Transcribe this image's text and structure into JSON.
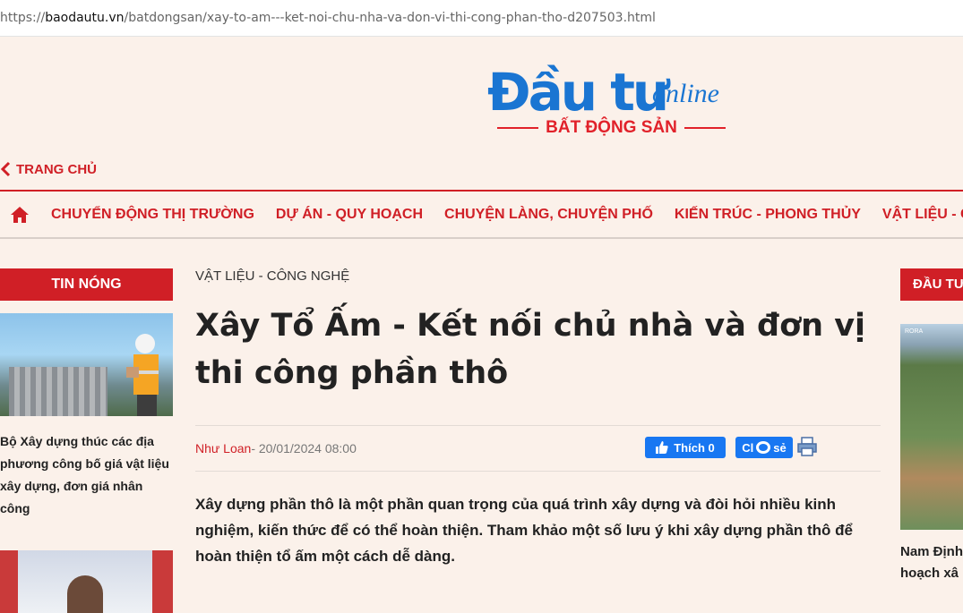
{
  "browser": {
    "url_prefix": "https://",
    "url_host": "baodautu.vn",
    "url_path": "/batdongsan/xay-to-am---ket-noi-chu-nha-va-don-vi-thi-cong-phan-tho-d207503.html"
  },
  "logo": {
    "main": "Đầu tư",
    "online": "online",
    "sub": "BẤT ĐỘNG SẢN",
    "colors": {
      "blue": "#1a75d2",
      "red": "#e1212a"
    }
  },
  "back_link": {
    "label": "TRANG CHỦ",
    "icon": "chevron-left-icon"
  },
  "nav": {
    "home_icon": "home-icon",
    "items": [
      "CHUYỂN ĐỘNG THỊ TRƯỜNG",
      "DỰ ÁN - QUY HOẠCH",
      "CHUYỆN LÀNG, CHUYỆN PHỐ",
      "KIẾN TRÚC - PHONG THỦY",
      "VẬT LIỆU - C"
    ]
  },
  "left_sidebar": {
    "header": "TIN NÓNG",
    "items": [
      {
        "title": "Bộ Xây dựng thúc các địa phương công bố giá vật liệu xây dựng, đơn giá nhân công"
      }
    ]
  },
  "article": {
    "category": "VẬT LIỆU - CÔNG NGHỆ",
    "title": "Xây Tổ Ấm - Kết nối chủ nhà và đơn vị thi công phần thô",
    "author": "Như Loan",
    "date": " - 20/01/2024 08:00",
    "like_label": "Thích",
    "like_count": "0",
    "share_label": "Cl",
    "share_suffix": "sẻ",
    "sapo": "Xây dựng phần thô là một phần quan trọng của quá trình xây dựng và đòi hỏi nhiều kinh nghiệm, kiến thức để có thể hoàn thiện. Tham khảo một số lưu ý khi xây dựng phần thô để hoàn thiện tổ ấm một cách dễ dàng."
  },
  "right_sidebar": {
    "header": "ĐẦU TƯ",
    "thumb_tag": "RORA",
    "item_title_line1": "Nam Định",
    "item_title_line2": "hoạch xâ"
  },
  "colors": {
    "background": "#fbf1ea",
    "accent_red": "#d01f26",
    "facebook_blue": "#1877f2"
  }
}
